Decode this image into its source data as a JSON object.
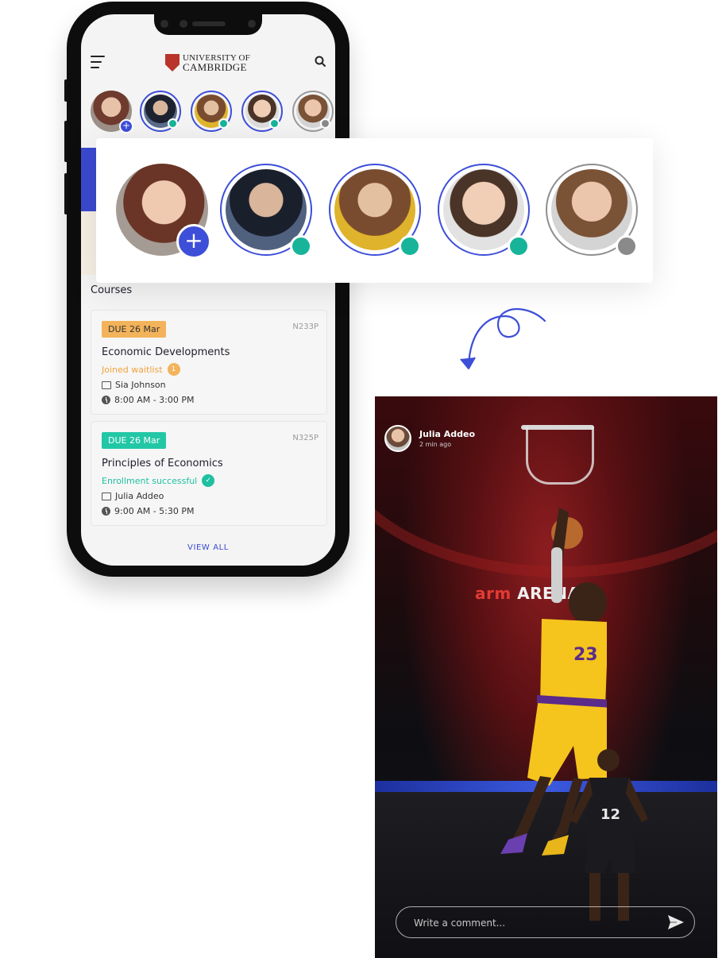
{
  "app": {
    "logo_line1": "UNIVERSITY OF",
    "logo_line2": "CAMBRIDGE"
  },
  "stories": [
    {
      "name": "my-story",
      "status": "add"
    },
    {
      "name": "story-2",
      "status": "online"
    },
    {
      "name": "story-3",
      "status": "online"
    },
    {
      "name": "story-4",
      "status": "online"
    },
    {
      "name": "story-5",
      "status": "offline"
    }
  ],
  "courses": {
    "title": "Courses",
    "items": [
      {
        "due": "DUE 26 Mar",
        "code": "N233P",
        "title": "Economic Developments",
        "status": "Joined waitlist",
        "badge": "1",
        "teacher": "Sia Johnson",
        "time": "8:00 AM - 3:00 PM"
      },
      {
        "due": "DUE 26 Mar",
        "code": "N325P",
        "title": "Principles of Economics",
        "status": "Enrollment successful",
        "badge": "✓",
        "teacher": "Julia Addeo",
        "time": "9:00 AM - 5:30 PM"
      }
    ],
    "view_all": "VIEW ALL"
  },
  "colors": {
    "accent": "#3d4ed8",
    "online": "#18b49a",
    "offline": "#8a8a8a",
    "waitlist": "#f0a33a",
    "success": "#1ec0a0"
  },
  "post": {
    "author": "Julia Addeo",
    "time": "2 min ago",
    "arena_prefix": "arm",
    "arena_word": "ARENA",
    "comment_placeholder": "Write a comment..."
  }
}
